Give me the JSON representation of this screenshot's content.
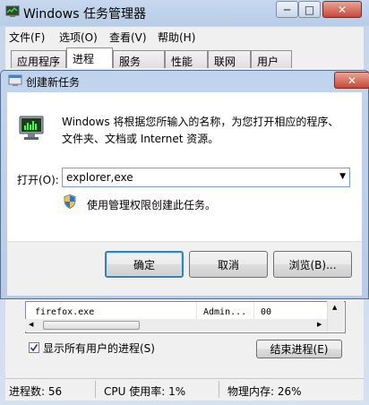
{
  "task_manager": {
    "title": "Windows 任务管理器",
    "window_buttons": {
      "minimize": "─",
      "maximize": "□",
      "close": "✕"
    },
    "menu": [
      "文件(F)",
      "选项(O)",
      "查看(V)",
      "帮助(H)"
    ],
    "tabs": [
      "应用程序",
      "进程",
      "服务",
      "性能",
      "联网",
      "用户"
    ],
    "active_tab": "进程",
    "process_row": {
      "name": "firefox.exe",
      "user": "Admin...",
      "cpu": "00"
    },
    "show_all_label": "显示所有用户的进程(S)",
    "end_process_button": "结束进程(E)",
    "status": {
      "processes": "进程数: 56",
      "cpu": "CPU 使用率: 1%",
      "memory": "物理内存: 26%"
    }
  },
  "dialog": {
    "title": "创建新任务",
    "description_line1": "Windows 将根据您所输入的名称，为您打开相应的程序、",
    "description_line2": "文件夹、文档或 Internet 资源。",
    "open_label": "打开(O):",
    "open_value": "explorer,exe",
    "admin_note": "使用管理权限创建此任务。",
    "ok_button": "确定",
    "cancel_button": "取消",
    "browse_button": "浏览(B)..."
  },
  "colors": {
    "title_bar": "#c7d8ee",
    "close_red": "#c7483a",
    "focus_blue": "#3c7fb1"
  }
}
